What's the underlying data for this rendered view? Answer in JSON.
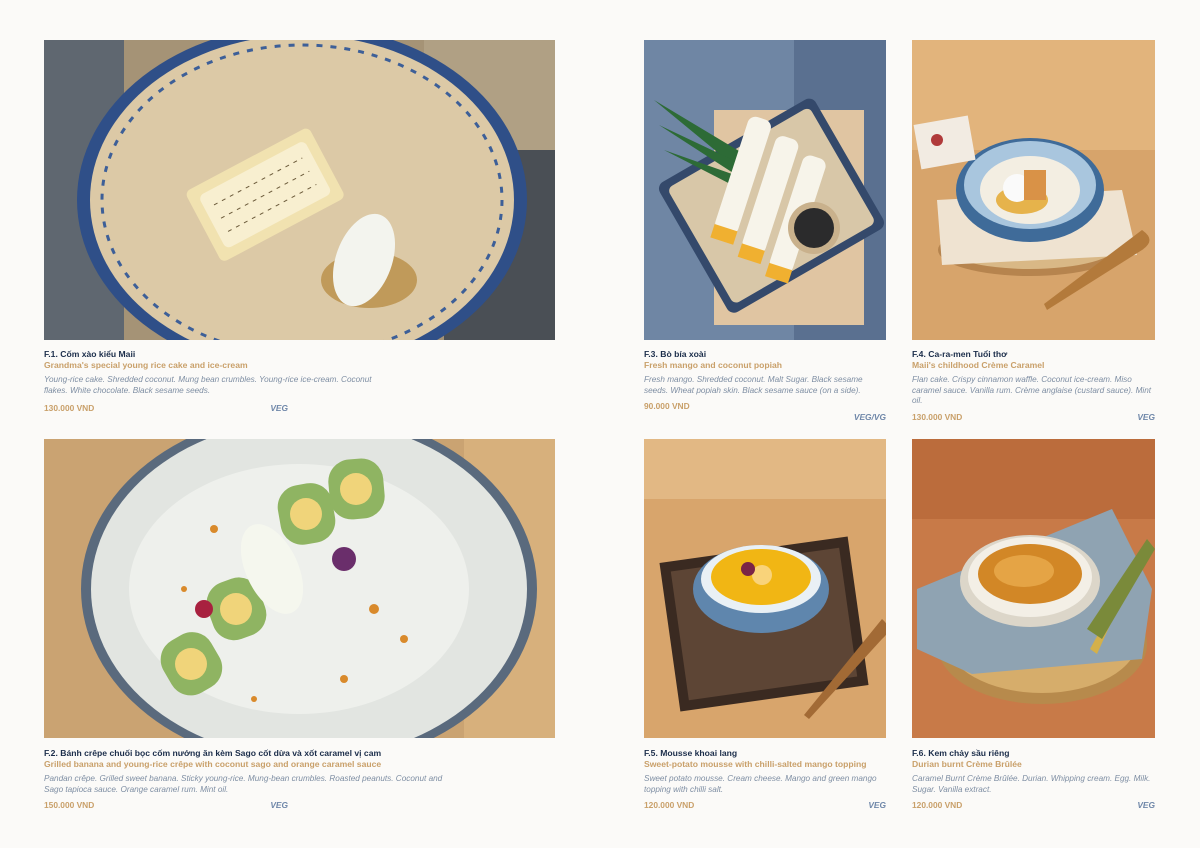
{
  "items": [
    {
      "code": "F.1.",
      "title_vi": "Cốm xào kiểu Maii",
      "title_en": "Grandma's special young rice cake and ice-cream",
      "description": "Young-rice cake. Shredded coconut. Mung bean crumbles. Young-rice ice-cream. Coconut flakes. White chocolate. Black sesame seeds.",
      "price": "130.000 VND",
      "tag": "VEG",
      "photo": "young-rice-cake-photo"
    },
    {
      "code": "F.2.",
      "title_vi": "Bánh crêpe chuối bọc cốm nướng ăn kèm Sago cốt dừa và xốt caramel vị cam",
      "title_en": "Grilled banana and young-rice crêpe with coconut sago and orange caramel sauce",
      "description": "Pandan crêpe. Grilled sweet banana. Sticky young-rice. Mung-bean crumbles. Roasted peanuts. Coconut and Sago tapioca sauce. Orange caramel rum. Mint oil.",
      "price": "150.000 VND",
      "tag": "VEG",
      "photo": "banana-crepe-photo"
    },
    {
      "code": "F.3.",
      "title_vi": "Bò bía xoài",
      "title_en": "Fresh mango and coconut popiah",
      "description": "Fresh mango. Shredded coconut. Malt Sugar. Black sesame seeds. Wheat popiah skin. Black sesame sauce (on a side).",
      "price": "90.000 VND",
      "tag": "VEG/VG",
      "photo": "mango-popiah-photo"
    },
    {
      "code": "F.4.",
      "title_vi": "Ca-ra-men Tuổi thơ",
      "title_en": "Maii's childhood Crème Caramel",
      "description": "Flan cake. Crispy cinnamon waffle. Coconut ice-cream. Miso caramel sauce. Vanilla rum. Crème anglaise (custard sauce). Mint oil.",
      "price": "130.000 VND",
      "tag": "VEG",
      "photo": "creme-caramel-photo"
    },
    {
      "code": "F.5.",
      "title_vi": "Mousse khoai lang",
      "title_en": "Sweet-potato mousse with chilli-salted mango topping",
      "description": "Sweet potato mousse. Cream cheese. Mango and green mango topping with chilli salt.",
      "price": "120.000 VND",
      "tag": "VEG",
      "photo": "sweet-potato-mousse-photo"
    },
    {
      "code": "F.6.",
      "title_vi": "Kem chảy sầu riêng",
      "title_en": "Durian burnt Crème Brûlée",
      "description": "Caramel Burnt Crème Brûlée. Durian. Whipping cream. Egg. Milk. Sugar. Vanilla extract.",
      "price": "120.000 VND",
      "tag": "VEG",
      "photo": "creme-brulee-photo"
    }
  ]
}
